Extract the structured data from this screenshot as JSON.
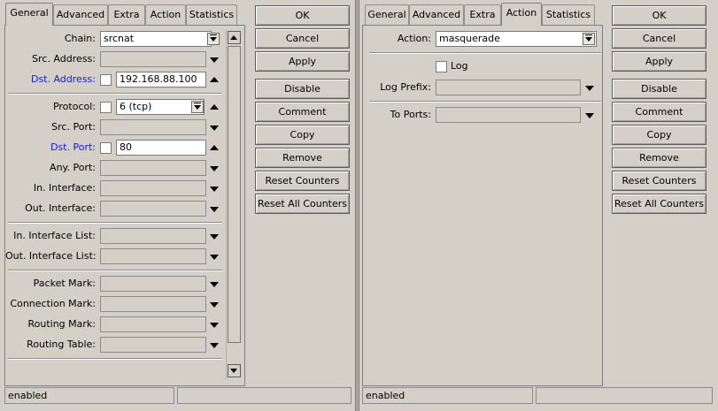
{
  "left_window": {
    "tabs": [
      {
        "label": "General",
        "active": true
      },
      {
        "label": "Advanced",
        "active": false
      },
      {
        "label": "Extra",
        "active": false
      },
      {
        "label": "Action",
        "active": false
      },
      {
        "label": "Statistics",
        "active": false
      }
    ],
    "fields": {
      "chain": {
        "label": "Chain:",
        "value": "srcnat"
      },
      "src_address": {
        "label": "Src. Address:",
        "value": ""
      },
      "dst_address": {
        "label": "Dst. Address:",
        "value": "192.168.88.100"
      },
      "protocol": {
        "label": "Protocol:",
        "value": "6 (tcp)"
      },
      "src_port": {
        "label": "Src. Port:",
        "value": ""
      },
      "dst_port": {
        "label": "Dst. Port:",
        "value": "80"
      },
      "any_port": {
        "label": "Any. Port:",
        "value": ""
      },
      "in_interface": {
        "label": "In. Interface:",
        "value": ""
      },
      "out_interface": {
        "label": "Out. Interface:",
        "value": ""
      },
      "in_interface_list": {
        "label": "In. Interface List:",
        "value": ""
      },
      "out_interface_list": {
        "label": "Out. Interface List:",
        "value": ""
      },
      "packet_mark": {
        "label": "Packet Mark:",
        "value": ""
      },
      "connection_mark": {
        "label": "Connection Mark:",
        "value": ""
      },
      "routing_mark": {
        "label": "Routing Mark:",
        "value": ""
      },
      "routing_table": {
        "label": "Routing Table:",
        "value": ""
      }
    },
    "buttons": {
      "ok": "OK",
      "cancel": "Cancel",
      "apply": "Apply",
      "disable": "Disable",
      "comment": "Comment",
      "copy": "Copy",
      "remove": "Remove",
      "reset_counters": "Reset Counters",
      "reset_all_counters": "Reset All Counters"
    },
    "status": "enabled"
  },
  "right_window": {
    "tabs": [
      {
        "label": "General",
        "active": false
      },
      {
        "label": "Advanced",
        "active": false
      },
      {
        "label": "Extra",
        "active": false
      },
      {
        "label": "Action",
        "active": true
      },
      {
        "label": "Statistics",
        "active": false
      }
    ],
    "fields": {
      "action": {
        "label": "Action:",
        "value": "masquerade"
      },
      "log": {
        "label": "Log",
        "checked": false
      },
      "log_prefix": {
        "label": "Log Prefix:",
        "value": ""
      },
      "to_ports": {
        "label": "To Ports:",
        "value": ""
      }
    },
    "buttons": {
      "ok": "OK",
      "cancel": "Cancel",
      "apply": "Apply",
      "disable": "Disable",
      "comment": "Comment",
      "copy": "Copy",
      "remove": "Remove",
      "reset_counters": "Reset Counters",
      "reset_all_counters": "Reset All Counters"
    },
    "status": "enabled"
  },
  "colors": {
    "background": "#d4d0c8",
    "link_label": "#1a1adc",
    "field_white": "#ffffff"
  }
}
